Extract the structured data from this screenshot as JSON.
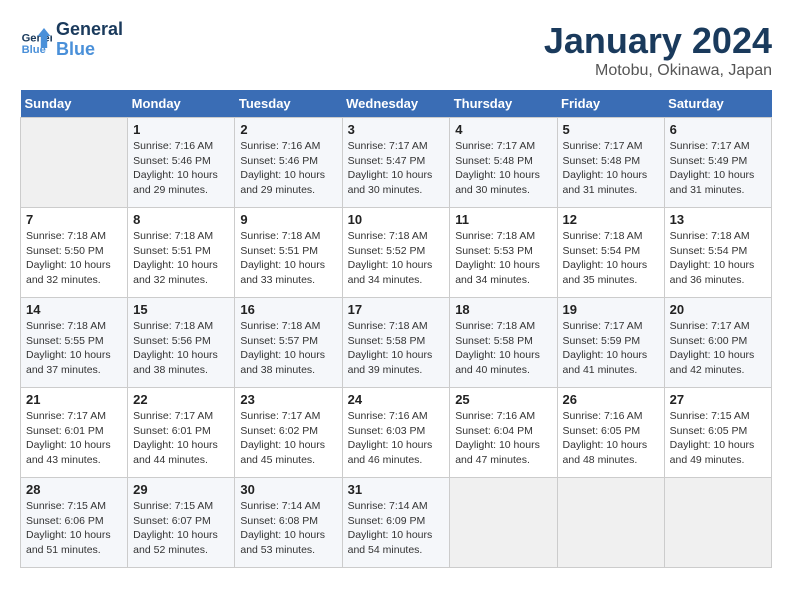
{
  "header": {
    "logo_line1": "General",
    "logo_line2": "Blue",
    "month_title": "January 2024",
    "location": "Motobu, Okinawa, Japan"
  },
  "days_of_week": [
    "Sunday",
    "Monday",
    "Tuesday",
    "Wednesday",
    "Thursday",
    "Friday",
    "Saturday"
  ],
  "weeks": [
    [
      {
        "num": "",
        "info": ""
      },
      {
        "num": "1",
        "info": "Sunrise: 7:16 AM\nSunset: 5:46 PM\nDaylight: 10 hours\nand 29 minutes."
      },
      {
        "num": "2",
        "info": "Sunrise: 7:16 AM\nSunset: 5:46 PM\nDaylight: 10 hours\nand 29 minutes."
      },
      {
        "num": "3",
        "info": "Sunrise: 7:17 AM\nSunset: 5:47 PM\nDaylight: 10 hours\nand 30 minutes."
      },
      {
        "num": "4",
        "info": "Sunrise: 7:17 AM\nSunset: 5:48 PM\nDaylight: 10 hours\nand 30 minutes."
      },
      {
        "num": "5",
        "info": "Sunrise: 7:17 AM\nSunset: 5:48 PM\nDaylight: 10 hours\nand 31 minutes."
      },
      {
        "num": "6",
        "info": "Sunrise: 7:17 AM\nSunset: 5:49 PM\nDaylight: 10 hours\nand 31 minutes."
      }
    ],
    [
      {
        "num": "7",
        "info": "Sunrise: 7:18 AM\nSunset: 5:50 PM\nDaylight: 10 hours\nand 32 minutes."
      },
      {
        "num": "8",
        "info": "Sunrise: 7:18 AM\nSunset: 5:51 PM\nDaylight: 10 hours\nand 32 minutes."
      },
      {
        "num": "9",
        "info": "Sunrise: 7:18 AM\nSunset: 5:51 PM\nDaylight: 10 hours\nand 33 minutes."
      },
      {
        "num": "10",
        "info": "Sunrise: 7:18 AM\nSunset: 5:52 PM\nDaylight: 10 hours\nand 34 minutes."
      },
      {
        "num": "11",
        "info": "Sunrise: 7:18 AM\nSunset: 5:53 PM\nDaylight: 10 hours\nand 34 minutes."
      },
      {
        "num": "12",
        "info": "Sunrise: 7:18 AM\nSunset: 5:54 PM\nDaylight: 10 hours\nand 35 minutes."
      },
      {
        "num": "13",
        "info": "Sunrise: 7:18 AM\nSunset: 5:54 PM\nDaylight: 10 hours\nand 36 minutes."
      }
    ],
    [
      {
        "num": "14",
        "info": "Sunrise: 7:18 AM\nSunset: 5:55 PM\nDaylight: 10 hours\nand 37 minutes."
      },
      {
        "num": "15",
        "info": "Sunrise: 7:18 AM\nSunset: 5:56 PM\nDaylight: 10 hours\nand 38 minutes."
      },
      {
        "num": "16",
        "info": "Sunrise: 7:18 AM\nSunset: 5:57 PM\nDaylight: 10 hours\nand 38 minutes."
      },
      {
        "num": "17",
        "info": "Sunrise: 7:18 AM\nSunset: 5:58 PM\nDaylight: 10 hours\nand 39 minutes."
      },
      {
        "num": "18",
        "info": "Sunrise: 7:18 AM\nSunset: 5:58 PM\nDaylight: 10 hours\nand 40 minutes."
      },
      {
        "num": "19",
        "info": "Sunrise: 7:17 AM\nSunset: 5:59 PM\nDaylight: 10 hours\nand 41 minutes."
      },
      {
        "num": "20",
        "info": "Sunrise: 7:17 AM\nSunset: 6:00 PM\nDaylight: 10 hours\nand 42 minutes."
      }
    ],
    [
      {
        "num": "21",
        "info": "Sunrise: 7:17 AM\nSunset: 6:01 PM\nDaylight: 10 hours\nand 43 minutes."
      },
      {
        "num": "22",
        "info": "Sunrise: 7:17 AM\nSunset: 6:01 PM\nDaylight: 10 hours\nand 44 minutes."
      },
      {
        "num": "23",
        "info": "Sunrise: 7:17 AM\nSunset: 6:02 PM\nDaylight: 10 hours\nand 45 minutes."
      },
      {
        "num": "24",
        "info": "Sunrise: 7:16 AM\nSunset: 6:03 PM\nDaylight: 10 hours\nand 46 minutes."
      },
      {
        "num": "25",
        "info": "Sunrise: 7:16 AM\nSunset: 6:04 PM\nDaylight: 10 hours\nand 47 minutes."
      },
      {
        "num": "26",
        "info": "Sunrise: 7:16 AM\nSunset: 6:05 PM\nDaylight: 10 hours\nand 48 minutes."
      },
      {
        "num": "27",
        "info": "Sunrise: 7:15 AM\nSunset: 6:05 PM\nDaylight: 10 hours\nand 49 minutes."
      }
    ],
    [
      {
        "num": "28",
        "info": "Sunrise: 7:15 AM\nSunset: 6:06 PM\nDaylight: 10 hours\nand 51 minutes."
      },
      {
        "num": "29",
        "info": "Sunrise: 7:15 AM\nSunset: 6:07 PM\nDaylight: 10 hours\nand 52 minutes."
      },
      {
        "num": "30",
        "info": "Sunrise: 7:14 AM\nSunset: 6:08 PM\nDaylight: 10 hours\nand 53 minutes."
      },
      {
        "num": "31",
        "info": "Sunrise: 7:14 AM\nSunset: 6:09 PM\nDaylight: 10 hours\nand 54 minutes."
      },
      {
        "num": "",
        "info": ""
      },
      {
        "num": "",
        "info": ""
      },
      {
        "num": "",
        "info": ""
      }
    ]
  ]
}
